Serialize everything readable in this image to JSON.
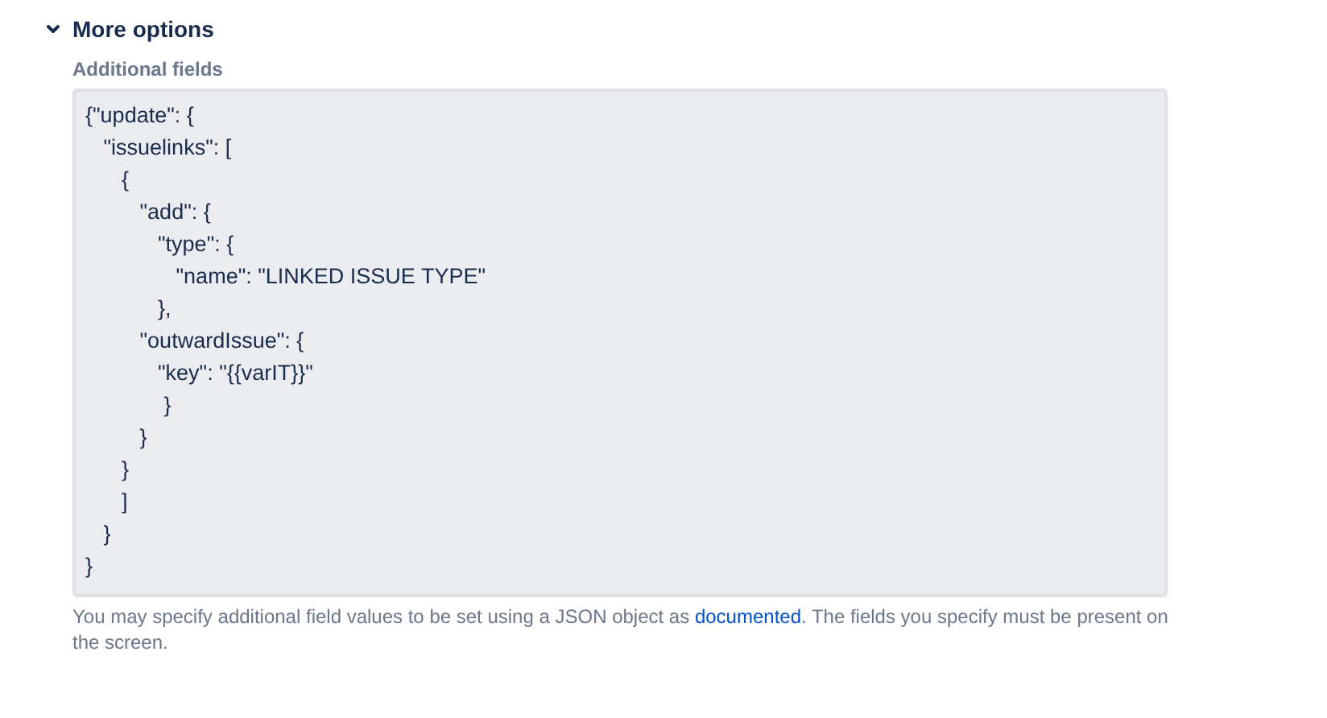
{
  "section": {
    "title": "More options",
    "expanded": true
  },
  "field": {
    "label": "Additional fields",
    "value": "{\"update\": {\n   \"issuelinks\": [\n      {\n         \"add\": {\n            \"type\": {\n               \"name\": \"LINKED ISSUE TYPE\"\n            },\n         \"outwardIssue\": {\n            \"key\": \"{{varIT}}\"\n             }\n         }\n      }\n      ]\n   }\n}"
  },
  "help": {
    "before": "You may specify additional field values to be set using a JSON object as ",
    "link": "documented",
    "after": ". The fields you specify must be present on the screen."
  }
}
